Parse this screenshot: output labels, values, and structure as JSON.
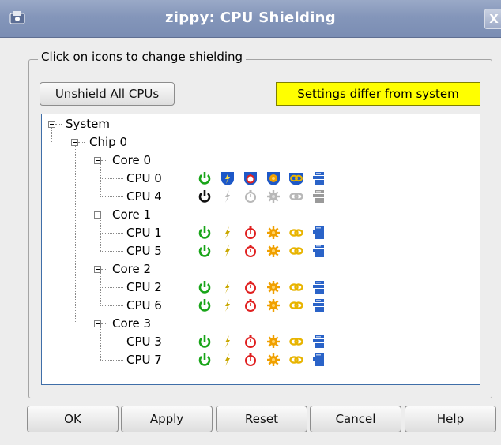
{
  "window": {
    "title": "zippy: CPU Shielding",
    "close_label": "X"
  },
  "group": {
    "legend": "Click on icons to change shielding"
  },
  "toolbar": {
    "unshield_label": "Unshield All CPUs",
    "status_text": "Settings differ from system",
    "status_color": "#ffff00"
  },
  "tree": {
    "root": "System",
    "chip": "Chip 0",
    "cores": [
      {
        "label": "Core 0",
        "cpus": [
          {
            "label": "CPU 0",
            "state": "shielded-blue"
          },
          {
            "label": "CPU 4",
            "state": "disabled-gray"
          }
        ]
      },
      {
        "label": "Core 1",
        "cpus": [
          {
            "label": "CPU 1",
            "state": "normal"
          },
          {
            "label": "CPU 5",
            "state": "normal"
          }
        ]
      },
      {
        "label": "Core 2",
        "cpus": [
          {
            "label": "CPU 2",
            "state": "normal"
          },
          {
            "label": "CPU 6",
            "state": "normal"
          }
        ]
      },
      {
        "label": "Core 3",
        "cpus": [
          {
            "label": "CPU 3",
            "state": "normal"
          },
          {
            "label": "CPU 7",
            "state": "normal"
          }
        ]
      }
    ],
    "icon_columns": [
      "power-icon",
      "lightning-interrupt-icon",
      "stopwatch-timer-icon",
      "gear-process-icon",
      "link-icon",
      "stack-icon"
    ]
  },
  "buttons": {
    "ok": "OK",
    "apply": "Apply",
    "reset": "Reset",
    "cancel": "Cancel",
    "help": "Help"
  },
  "colors": {
    "titlebar": "#8496ba",
    "power_on": "#19a519",
    "lightning": "#c9a800",
    "timer": "#e02020",
    "gear": "#f0a000",
    "link": "#e8b400",
    "stack": "#2a63c8",
    "shield_blue": "#1d58c8",
    "disabled": "#b8b8b8"
  }
}
